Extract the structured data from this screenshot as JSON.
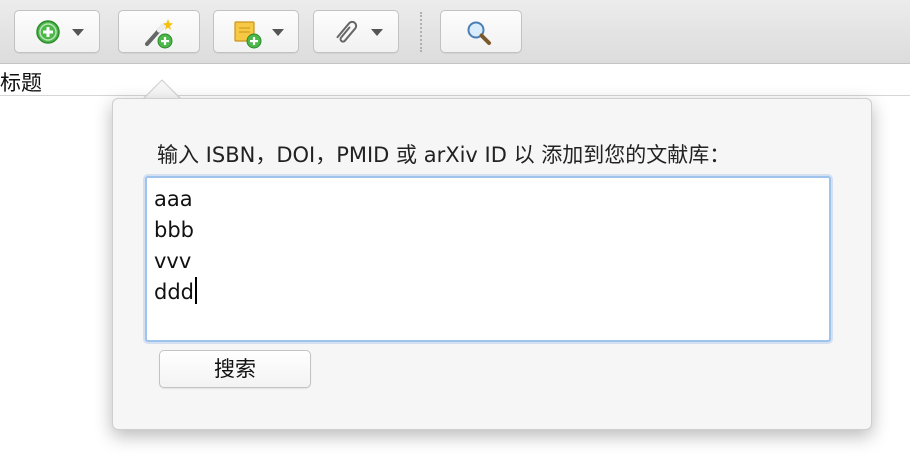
{
  "toolbar": {
    "buttons": [
      {
        "name": "new-item",
        "icon": "add-circle-icon",
        "has_dropdown": true
      },
      {
        "name": "add-by-identifier",
        "icon": "magic-wand-add-icon",
        "has_dropdown": false
      },
      {
        "name": "new-note",
        "icon": "note-add-icon",
        "has_dropdown": true
      },
      {
        "name": "add-attachment",
        "icon": "paperclip-icon",
        "has_dropdown": true
      },
      {
        "name": "search",
        "icon": "magnifier-icon",
        "has_dropdown": false
      }
    ]
  },
  "column_header": {
    "title_label": "标题"
  },
  "popover": {
    "prompt": "输入 ISBN，DOI，PMID 或 arXiv ID 以 添加到您的文献库：",
    "input_lines": [
      "aaa",
      "bbb",
      "vvv",
      "ddd"
    ],
    "search_button_label": "搜索"
  },
  "colors": {
    "accent_focus": "#9fc4ec",
    "add_green": "#4cb84a",
    "note_yellow": "#f7c844"
  }
}
